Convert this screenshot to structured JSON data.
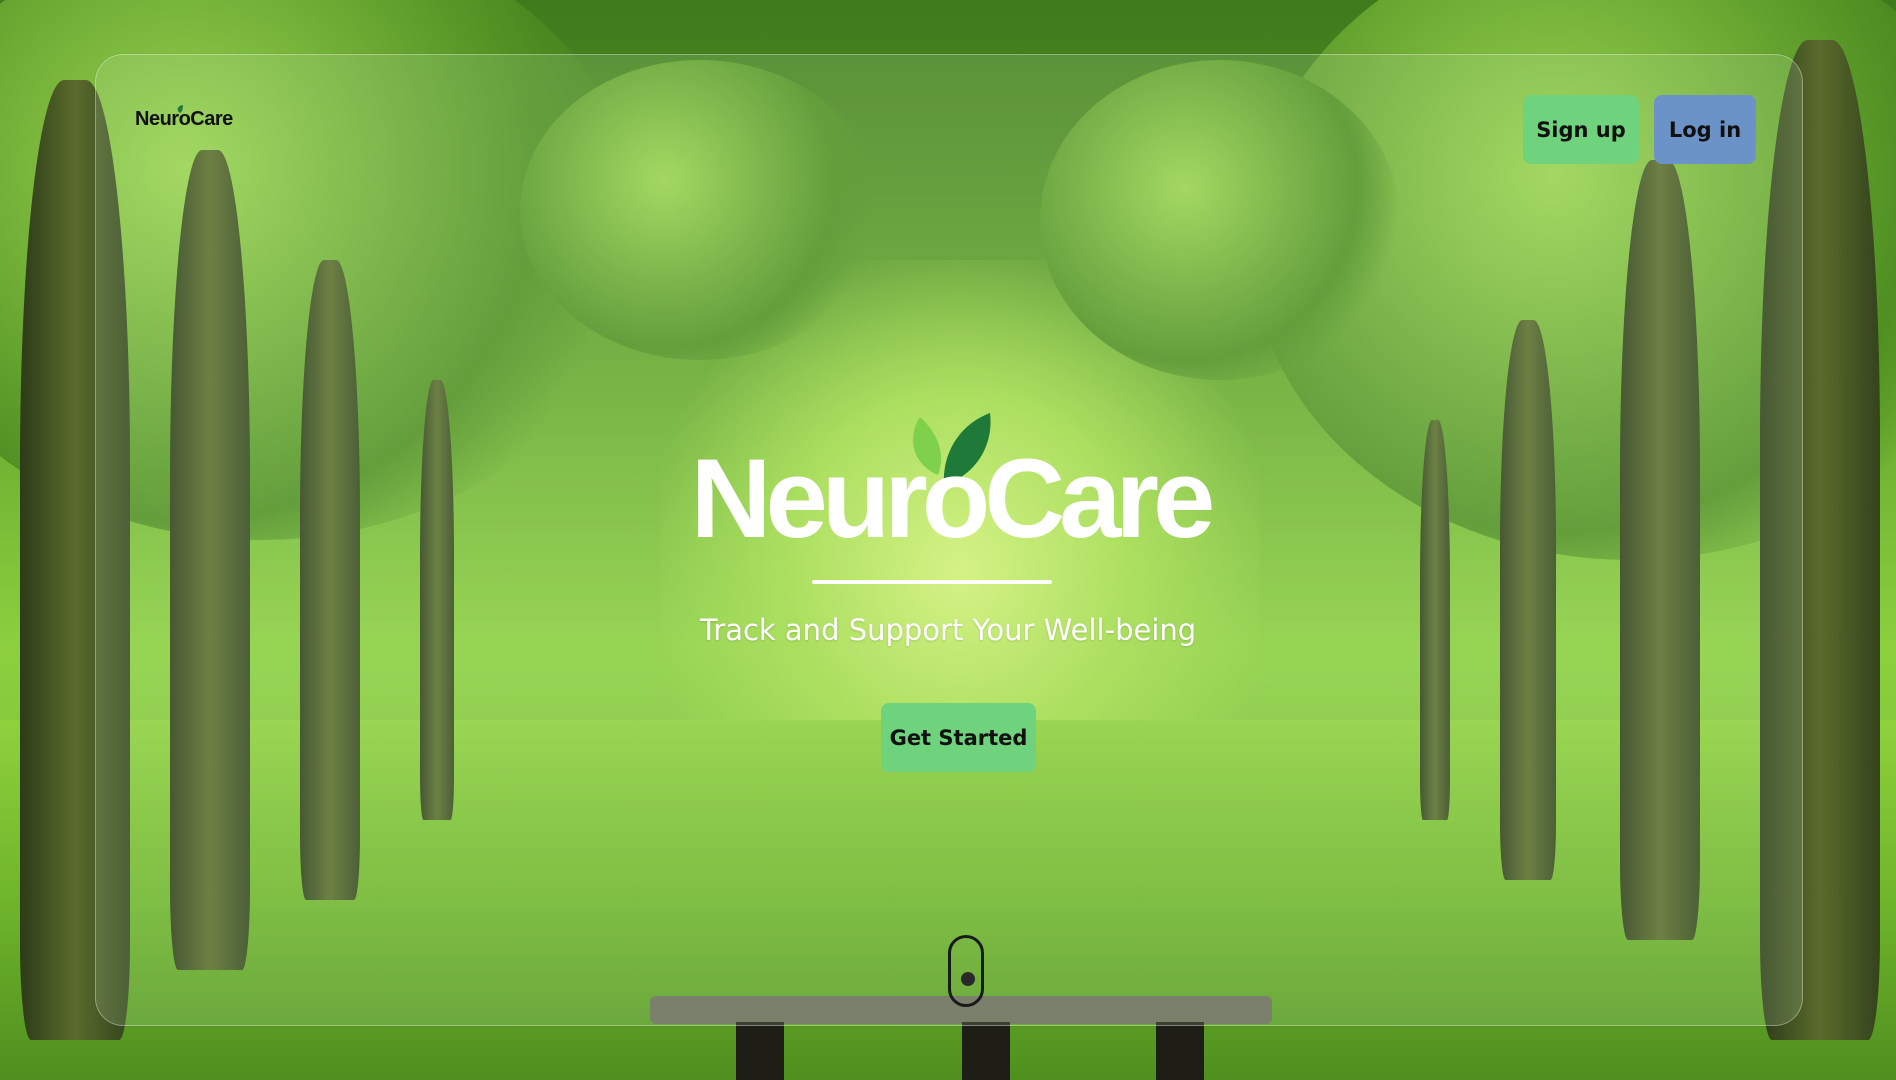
{
  "nav": {
    "logo_text": "NeuroCare",
    "signup_label": "Sign up",
    "login_label": "Log in"
  },
  "hero": {
    "logo_text": "NeuroCare",
    "tagline": "Track and Support Your Well-being",
    "cta_label": "Get Started"
  },
  "colors": {
    "primary_green": "#6fd27d",
    "login_blue": "#6b93c8",
    "leaf_light": "#7fd04a",
    "leaf_dark": "#1f7a3a"
  },
  "icons": {
    "scroll": "mouse-scroll-icon"
  }
}
